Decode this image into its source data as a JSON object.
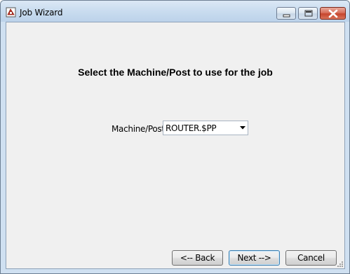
{
  "window": {
    "title": "Job Wizard",
    "icon": "job-wizard-app-icon"
  },
  "caption_buttons": {
    "minimize_icon": "minimize-icon",
    "maximize_icon": "maximize-icon",
    "close_icon": "close-icon"
  },
  "main": {
    "heading": "Select the Machine/Post to use for the job",
    "machine_label": "Machine/Post",
    "machine_value": "ROUTER.$PP"
  },
  "buttons": {
    "back": "<-- Back",
    "next": "Next -->",
    "cancel": "Cancel"
  },
  "colors": {
    "close_button": "#c6452d",
    "client_background": "#f0f0f0",
    "titlebar": "#c9dcef"
  }
}
